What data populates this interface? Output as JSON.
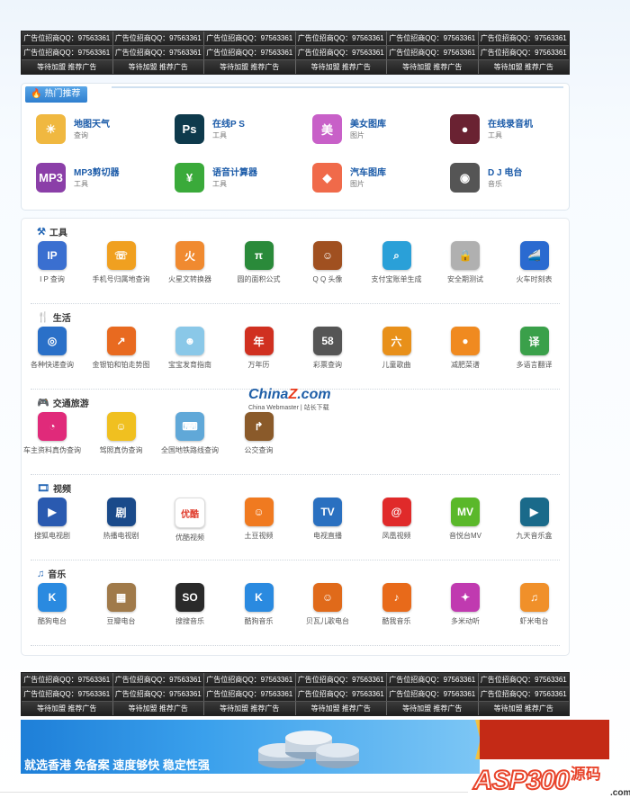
{
  "ad_top": {
    "rows": [
      [
        "广告位招商QQ：97563361",
        "广告位招商QQ：97563361",
        "广告位招商QQ：97563361",
        "广告位招商QQ：97563361",
        "广告位招商QQ：97563361",
        "广告位招商QQ：97563361"
      ],
      [
        "广告位招商QQ：97563361",
        "广告位招商QQ：97563361",
        "广告位招商QQ：97563361",
        "广告位招商QQ：97563361",
        "广告位招商QQ：97563361",
        "广告位招商QQ：97563361"
      ],
      [
        "等待加盟 推荐广告",
        "等待加盟 推荐广告",
        "等待加盟 推荐广告",
        "等待加盟 推荐广告",
        "等待加盟 推荐广告",
        "等待加盟 推荐广告"
      ]
    ]
  },
  "hot": {
    "title": "热门推荐",
    "items": [
      {
        "name": "地图天气",
        "sub": "查询",
        "icon": "weather-icon",
        "color": "#f0b840",
        "glyph": "☀"
      },
      {
        "name": "在线P S",
        "sub": "工具",
        "icon": "photoshop-icon",
        "color": "#0e3a4c",
        "glyph": "Ps"
      },
      {
        "name": "美女图库",
        "sub": "图片",
        "icon": "beauty-gallery-icon",
        "color": "#c860c8",
        "glyph": "美"
      },
      {
        "name": "在线录音机",
        "sub": "工具",
        "icon": "recorder-icon",
        "color": "#6a2232",
        "glyph": "●"
      },
      {
        "name": "MP3剪切器",
        "sub": "工具",
        "icon": "mp3-cutter-icon",
        "color": "#8b3fa8",
        "glyph": "MP3"
      },
      {
        "name": "语音计算器",
        "sub": "工具",
        "icon": "calculator-icon",
        "color": "#3aaa3a",
        "glyph": "¥"
      },
      {
        "name": "汽车图库",
        "sub": "图片",
        "icon": "car-gallery-icon",
        "color": "#f06a4a",
        "glyph": "◆"
      },
      {
        "name": "D J 电台",
        "sub": "音乐",
        "icon": "dj-radio-icon",
        "color": "#555555",
        "glyph": "◉"
      }
    ]
  },
  "categories": [
    {
      "title": "工具",
      "icon": "toolbox-icon",
      "glyph": "⚒",
      "apps": [
        {
          "label": "I P 查询",
          "icon": "ip-query-icon",
          "color": "#3a6fd0",
          "glyph": "IP"
        },
        {
          "label": "手机号归属地查询",
          "icon": "phone-location-icon",
          "color": "#f0a020",
          "glyph": "☏"
        },
        {
          "label": "火星文转换器",
          "icon": "martian-text-icon",
          "color": "#f08a30",
          "glyph": "火"
        },
        {
          "label": "圆的面积公式",
          "icon": "circle-formula-icon",
          "color": "#2a8a3a",
          "glyph": "π"
        },
        {
          "label": "Q Q 头像",
          "icon": "qq-avatar-icon",
          "color": "#a05020",
          "glyph": "☺"
        },
        {
          "label": "支付宝账单生成",
          "icon": "alipay-bill-icon",
          "color": "#2aa0d8",
          "glyph": "⌕"
        },
        {
          "label": "安全期测试",
          "icon": "safe-period-icon",
          "color": "#b0b0b0",
          "glyph": "🔒"
        },
        {
          "label": "火车时刻表",
          "icon": "train-schedule-icon",
          "color": "#2a6ad0",
          "glyph": "🚄"
        }
      ]
    },
    {
      "title": "生活",
      "icon": "cutlery-icon",
      "glyph": "🍴",
      "apps": [
        {
          "label": "各种快递查询",
          "icon": "express-query-icon",
          "color": "#2a70c8",
          "glyph": "◎"
        },
        {
          "label": "金银铂和铂走势图",
          "icon": "precious-metal-icon",
          "color": "#e86a20",
          "glyph": "↗"
        },
        {
          "label": "宝宝发育指南",
          "icon": "baby-guide-icon",
          "color": "#8ac8e8",
          "glyph": "☻"
        },
        {
          "label": "万年历",
          "icon": "calendar-icon",
          "color": "#d03020",
          "glyph": "年"
        },
        {
          "label": "彩票查询",
          "icon": "lottery-icon",
          "color": "#555555",
          "glyph": "58"
        },
        {
          "label": "儿童歌曲",
          "icon": "kids-song-icon",
          "color": "#e8901a",
          "glyph": "六"
        },
        {
          "label": "减肥菜谱",
          "icon": "diet-recipe-icon",
          "color": "#f08a20",
          "glyph": "●"
        },
        {
          "label": "多语言翻译",
          "icon": "translate-icon",
          "color": "#3aa04a",
          "glyph": "译"
        }
      ]
    },
    {
      "title": "交通旅游",
      "icon": "gamepad-icon",
      "glyph": "🎮",
      "apps": [
        {
          "label": "车主资料真伪查询",
          "icon": "car-owner-icon",
          "color": "#e02a7a",
          "glyph": "◔"
        },
        {
          "label": "驾照真伪查询",
          "icon": "driver-license-icon",
          "color": "#f0c020",
          "glyph": "☺"
        },
        {
          "label": "全国地铁路线查询",
          "icon": "subway-icon",
          "color": "#60a8d8",
          "glyph": "⌨"
        },
        {
          "label": "公交查询",
          "icon": "bus-query-icon",
          "color": "#8a5a2a",
          "glyph": "↱"
        }
      ]
    },
    {
      "title": "视频",
      "icon": "film-icon",
      "glyph": "🎞",
      "apps": [
        {
          "label": "搜狐电视剧",
          "icon": "sohu-tv-icon",
          "color": "#2a5ab0",
          "glyph": "▶"
        },
        {
          "label": "热播电视剧",
          "icon": "hot-drama-icon",
          "color": "#1a4a8a",
          "glyph": "剧"
        },
        {
          "label": "优酷视频",
          "icon": "youku-icon",
          "color": "#ffffff",
          "glyph": "优酷"
        },
        {
          "label": "土豆视频",
          "icon": "tudou-icon",
          "color": "#f07a20",
          "glyph": "☺"
        },
        {
          "label": "电视直播",
          "icon": "tv-live-icon",
          "color": "#2a70c0",
          "glyph": "TV"
        },
        {
          "label": "凤凰视频",
          "icon": "phoenix-video-icon",
          "color": "#e02a2a",
          "glyph": "@"
        },
        {
          "label": "音悦台MV",
          "icon": "yinyuetai-icon",
          "color": "#5ab82a",
          "glyph": "MV"
        },
        {
          "label": "九天音乐盒",
          "icon": "music-box-icon",
          "color": "#1a6a8a",
          "glyph": "▶"
        }
      ]
    },
    {
      "title": "音乐",
      "icon": "music-note-icon",
      "glyph": "♫",
      "apps": [
        {
          "label": "酷狗电台",
          "icon": "kugou-radio-icon",
          "color": "#2a8ae0",
          "glyph": "K"
        },
        {
          "label": "豆瓣电台",
          "icon": "douban-radio-icon",
          "color": "#a07a4a",
          "glyph": "▦"
        },
        {
          "label": "搜搜音乐",
          "icon": "soso-music-icon",
          "color": "#2a2a2a",
          "glyph": "SO"
        },
        {
          "label": "酷狗音乐",
          "icon": "kugou-music-icon",
          "color": "#2a8ae0",
          "glyph": "K"
        },
        {
          "label": "贝瓦儿歌电台",
          "icon": "beva-song-icon",
          "color": "#e06a1a",
          "glyph": "☺"
        },
        {
          "label": "酷我音乐",
          "icon": "kuwo-music-icon",
          "color": "#e86a1a",
          "glyph": "♪"
        },
        {
          "label": "多米动听",
          "icon": "duomi-icon",
          "color": "#c03ab0",
          "glyph": "✦"
        },
        {
          "label": "虾米电台",
          "icon": "xiami-radio-icon",
          "color": "#f0902a",
          "glyph": "♫"
        }
      ]
    }
  ],
  "watermark": {
    "brand_main": "China",
    "brand_z": "Z",
    "brand_tail": ".com",
    "sub": "China Webmaster | 站长下载"
  },
  "ad_bottom": {
    "rows": [
      [
        "广告位招商QQ：97563361",
        "广告位招商QQ：97563361",
        "广告位招商QQ：97563361",
        "广告位招商QQ：97563361",
        "广告位招商QQ：97563361",
        "广告位招商QQ：97563361"
      ],
      [
        "广告位招商QQ：97563361",
        "广告位招商QQ：97563361",
        "广告位招商QQ：97563361",
        "广告位招商QQ：97563361",
        "广告位招商QQ：97563361",
        "广告位招商QQ：97563361"
      ],
      [
        "等待加盟 推荐广告",
        "等待加盟 推荐广告",
        "等待加盟 推荐广告",
        "等待加盟 推荐广告",
        "等待加盟 推荐广告",
        "等待加盟 推荐广告"
      ]
    ]
  },
  "banner": {
    "text": "就选香港 免备案 速度够快 稳定性强"
  },
  "logo": {
    "asp": "ASP300",
    "yuan": "源码",
    "com": ".com"
  }
}
